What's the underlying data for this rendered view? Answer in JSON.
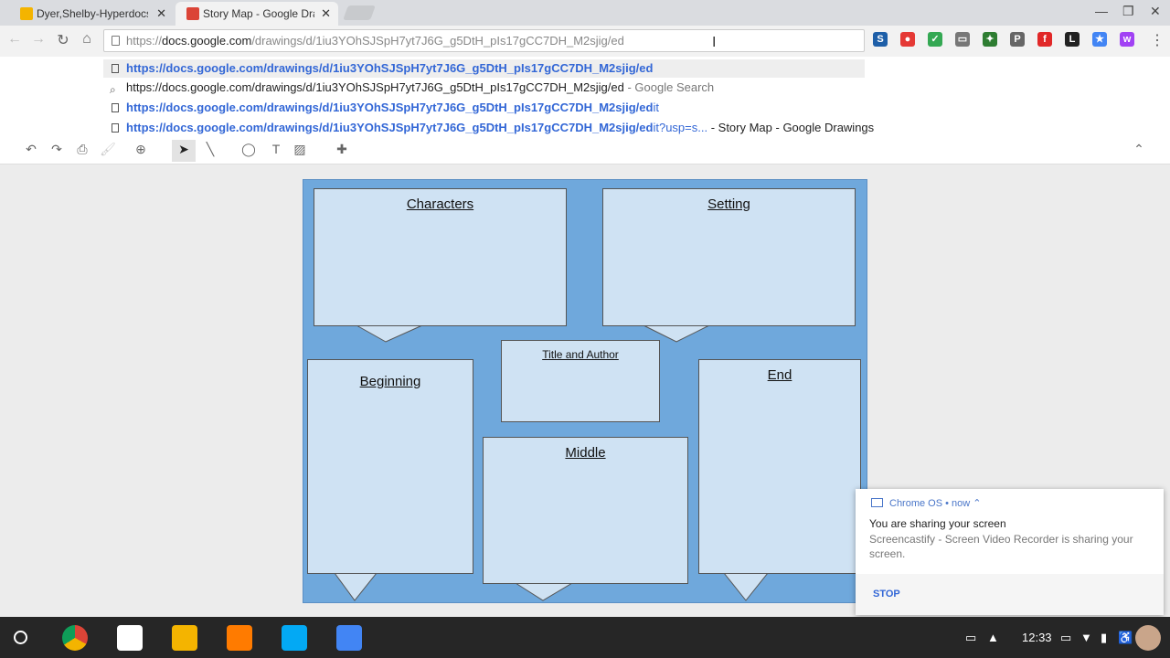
{
  "browser": {
    "tabs": [
      {
        "title": "Dyer,Shelby-Hyperdocs L",
        "favicon_color": "#f4b400"
      },
      {
        "title": "Story Map - Google Draw",
        "favicon_color": "#db4437"
      }
    ],
    "close_glyph": "✕",
    "omnibox": {
      "scheme": "https://",
      "host": "docs.google.com",
      "path": "/drawings/d/1iu3YOhSJSpH7yt7J6G_g5DtH_pIs17gCC7DH_M2sjig/ed"
    },
    "suggestions": [
      {
        "url": "https://docs.google.com/drawings/d/1iu3YOhSJSpH7yt7J6G_g5DtH_pIs17gCC7DH_M2sjig/ed",
        "suffix": "",
        "extra": ""
      },
      {
        "url": "https://docs.google.com/drawings/d/1iu3YOhSJSpH7yt7J6G_g5DtH_pIs17gCC7DH_M2sjig/ed",
        "suffix": "",
        "extra": " - Google Search"
      },
      {
        "url": "https://docs.google.com/drawings/d/1iu3YOhSJSpH7yt7J6G_g5DtH_pIs17gCC7DH_M2sjig/ed",
        "suffix": "it",
        "extra": ""
      },
      {
        "url": "https://docs.google.com/drawings/d/1iu3YOhSJSpH7yt7J6G_g5DtH_pIs17gCC7DH_M2sjig/ed",
        "suffix": "it?usp=s...",
        "extra": " - Story Map - Google Drawings"
      }
    ],
    "extensions": [
      {
        "name": "screencastify-icon",
        "glyph": "S",
        "color": "#1e5fa8"
      },
      {
        "name": "record-icon",
        "glyph": "●",
        "color": "#e53935"
      },
      {
        "name": "green-ext-icon",
        "glyph": "✓",
        "color": "#34a853"
      },
      {
        "name": "cast-icon",
        "glyph": "▭",
        "color": "#777777"
      },
      {
        "name": "puzzle-ext-icon",
        "glyph": "✦",
        "color": "#2e7d32"
      },
      {
        "name": "pinterest-icon",
        "glyph": "P",
        "color": "#666666"
      },
      {
        "name": "flipboard-icon",
        "glyph": "f",
        "color": "#e12828"
      },
      {
        "name": "l-ext-icon",
        "glyph": "L",
        "color": "#222222"
      },
      {
        "name": "star-ext-icon",
        "glyph": "★",
        "color": "#4285f4"
      },
      {
        "name": "purple-ext-icon",
        "glyph": "w",
        "color": "#a142f4"
      }
    ]
  },
  "drawing": {
    "boxes": {
      "characters": "Characters",
      "setting": "Setting",
      "title_author": "Title and Author",
      "beginning": "Beginning",
      "middle": "Middle",
      "end": "End"
    },
    "colors": {
      "page": "#6fa8dc",
      "box": "#cfe2f3"
    }
  },
  "notification": {
    "source": "Chrome OS",
    "time": "now",
    "title": "You are sharing your screen",
    "message": "Screencastify - Screen Video Recorder is sharing your screen.",
    "action": "STOP"
  },
  "shelf": {
    "apps": [
      {
        "name": "chrome-app-icon",
        "color": "#4285f4"
      },
      {
        "name": "gmail-app-icon",
        "color": "#ffffff"
      },
      {
        "name": "slides-app-icon",
        "color": "#f4b400"
      },
      {
        "name": "play-music-app-icon",
        "color": "#ff7b00"
      },
      {
        "name": "files-app-icon",
        "color": "#03a9f4"
      },
      {
        "name": "docs-app-icon",
        "color": "#4285f4"
      }
    ],
    "time": "12:33"
  }
}
